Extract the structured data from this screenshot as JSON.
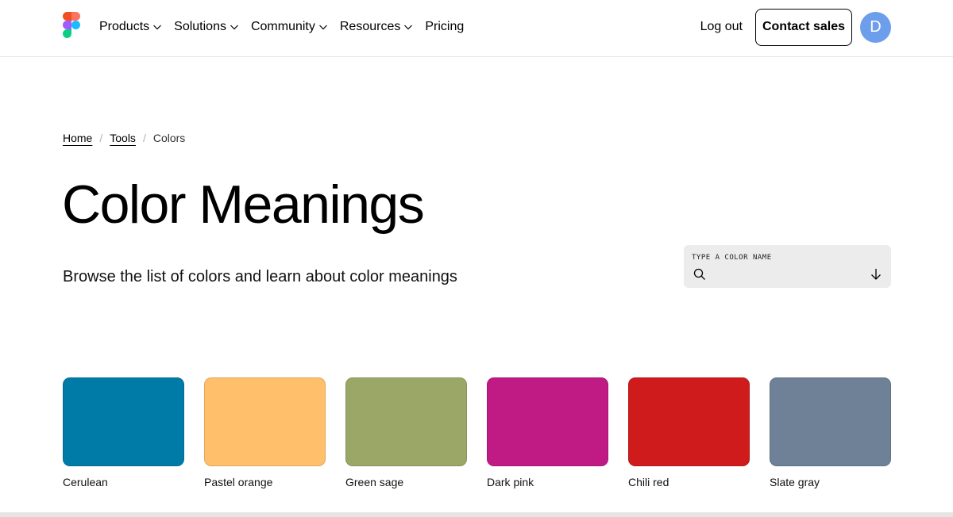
{
  "header": {
    "nav": [
      {
        "label": "Products",
        "dropdown": true
      },
      {
        "label": "Solutions",
        "dropdown": true
      },
      {
        "label": "Community",
        "dropdown": true
      },
      {
        "label": "Resources",
        "dropdown": true
      },
      {
        "label": "Pricing",
        "dropdown": false
      }
    ],
    "logout_label": "Log out",
    "contact_label": "Contact sales",
    "avatar_initial": "D",
    "avatar_color": "#6d9eeb"
  },
  "breadcrumb": {
    "items": [
      "Home",
      "Tools"
    ],
    "current": "Colors",
    "separator": "/"
  },
  "page": {
    "title": "Color Meanings",
    "subtitle": "Browse the list of colors and learn about color meanings"
  },
  "search": {
    "label": "TYPE A COLOR NAME",
    "value": "",
    "icon": "search-icon",
    "sort_icon": "arrow-down-icon"
  },
  "swatches": [
    {
      "name": "Cerulean",
      "color": "#007ba7"
    },
    {
      "name": "Pastel orange",
      "color": "#ffbf6b"
    },
    {
      "name": "Green sage",
      "color": "#9aa766"
    },
    {
      "name": "Dark pink",
      "color": "#c01a85"
    },
    {
      "name": "Chili red",
      "color": "#cf1b1b"
    },
    {
      "name": "Slate gray",
      "color": "#6e8197"
    }
  ]
}
